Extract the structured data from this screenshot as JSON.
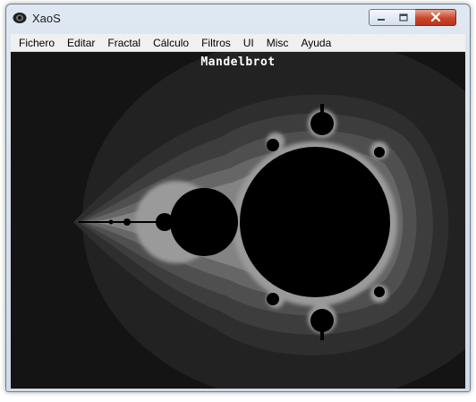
{
  "window": {
    "title": "XaoS"
  },
  "menu": {
    "items": [
      "Fichero",
      "Editar",
      "Fractal",
      "Cálculo",
      "Filtros",
      "UI",
      "Misc",
      "Ayuda"
    ]
  },
  "canvas": {
    "fractal_name": "Mandelbrot"
  },
  "colors": {
    "background": "#141414",
    "set": "#000000",
    "bands": [
      "#2a2a2a",
      "#3c3c3c",
      "#545454",
      "#6e6e6e",
      "#8a8a8a"
    ]
  },
  "icons": {
    "app": "eye-icon",
    "minimize": "minimize-icon",
    "maximize": "maximize-icon",
    "close": "close-icon"
  }
}
